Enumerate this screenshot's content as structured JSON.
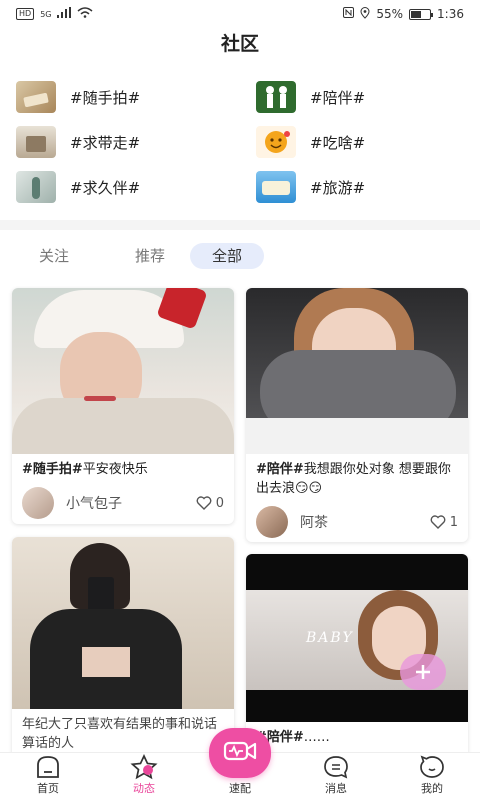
{
  "status_bar": {
    "left_badge": "HD",
    "network": "5G",
    "battery_text": "55%",
    "battery_level": 0.55,
    "time": "1:36"
  },
  "header": {
    "title": "社区"
  },
  "topics": [
    {
      "label": "#随手拍#",
      "icon": "random-photo-thumb"
    },
    {
      "label": "#陪伴#",
      "icon": "companion-thumb"
    },
    {
      "label": "#求带走#",
      "icon": "take-me-away-thumb"
    },
    {
      "label": "#吃啥#",
      "icon": "food-thumb"
    },
    {
      "label": "#求久伴#",
      "icon": "long-companion-thumb"
    },
    {
      "label": "#旅游#",
      "icon": "travel-thumb"
    }
  ],
  "tabs": [
    "关注",
    "推荐",
    "全部"
  ],
  "active_tab": "全部",
  "posts": [
    {
      "tag": "#随手拍#",
      "text": "平安夜快乐",
      "author": "小气包子",
      "likes": "0"
    },
    {
      "tag": "#陪伴#",
      "text": "我想跟你处对象 想要跟你出去浪😏😏",
      "author": "阿茶",
      "likes": "1"
    },
    {
      "tag": "",
      "text": "年纪大了只喜欢有结果的事和说话算话的人",
      "author": "",
      "likes": ""
    },
    {
      "tag": "#陪伴#",
      "text": "……",
      "author": "",
      "likes": "",
      "photo_text": "BABY"
    }
  ],
  "bottom_nav": [
    {
      "label": "首页",
      "icon": "home-icon"
    },
    {
      "label": "动态",
      "icon": "star-icon"
    },
    {
      "label": "速配",
      "icon": "video-match-icon"
    },
    {
      "label": "消息",
      "icon": "message-icon"
    },
    {
      "label": "我的",
      "icon": "profile-icon"
    }
  ],
  "colors": {
    "accent": "#ee4ea3",
    "active_tab_bg": "#e6ecfb",
    "nav_active": "#e9469a"
  }
}
